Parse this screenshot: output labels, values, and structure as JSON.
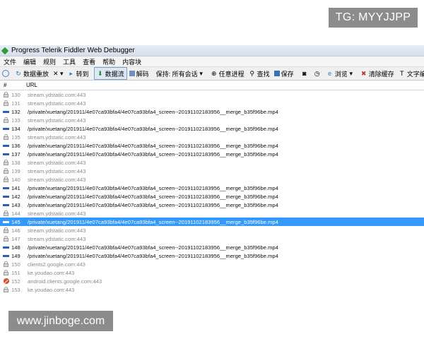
{
  "watermark_top": "TG: MYYJJPP",
  "watermark_bottom": "www.jinboge.com",
  "window": {
    "title": "Progress Telerik Fiddler Web Debugger"
  },
  "menu": [
    "文件",
    "编辑",
    "规则",
    "工具",
    "查看",
    "帮助",
    "内容块"
  ],
  "toolbar": {
    "comment_icon": "speech-bubble-icon",
    "replay": "数据重放",
    "remove": "✕ ▾",
    "goto": "转到",
    "stream": "数据流",
    "decode": "解码",
    "keep": "保持: 所有会话",
    "any_process": "任意进程",
    "find": "查找",
    "save": "保存",
    "browse": "浏览",
    "clear_cache": "清除缓存",
    "text_wizard": "文字编/解"
  },
  "columns": {
    "num": "#",
    "url": "URL"
  },
  "sessions": [
    {
      "num": "130",
      "url": "stream.ydstatic.com:443",
      "type": "tunnel"
    },
    {
      "num": "131",
      "url": "stream.ydstatic.com:443",
      "type": "tunnel"
    },
    {
      "num": "132",
      "url": "/private/xuetang/201911/4e07ca93bfa4/4e07ca93bfa4_screen--20191102183956__merge_b35f96be.mp4",
      "type": "media"
    },
    {
      "num": "133",
      "url": "stream.ydstatic.com:443",
      "type": "tunnel"
    },
    {
      "num": "134",
      "url": "/private/xuetang/201911/4e07ca93bfa4/4e07ca93bfa4_screen--20191102183956__merge_b35f96be.mp4",
      "type": "media"
    },
    {
      "num": "135",
      "url": "stream.ydstatic.com:443",
      "type": "tunnel"
    },
    {
      "num": "136",
      "url": "/private/xuetang/201911/4e07ca93bfa4/4e07ca93bfa4_screen--20191102183956__merge_b35f96be.mp4",
      "type": "media"
    },
    {
      "num": "137",
      "url": "/private/xuetang/201911/4e07ca93bfa4/4e07ca93bfa4_screen--20191102183956__merge_b35f96be.mp4",
      "type": "media"
    },
    {
      "num": "138",
      "url": "stream.ydstatic.com:443",
      "type": "tunnel"
    },
    {
      "num": "139",
      "url": "stream.ydstatic.com:443",
      "type": "tunnel"
    },
    {
      "num": "140",
      "url": "stream.ydstatic.com:443",
      "type": "tunnel"
    },
    {
      "num": "141",
      "url": "/private/xuetang/201911/4e07ca93bfa4/4e07ca93bfa4_screen--20191102183956__merge_b35f96be.mp4",
      "type": "media"
    },
    {
      "num": "142",
      "url": "/private/xuetang/201911/4e07ca93bfa4/4e07ca93bfa4_screen--20191102183956__merge_b35f96be.mp4",
      "type": "media"
    },
    {
      "num": "143",
      "url": "/private/xuetang/201911/4e07ca93bfa4/4e07ca93bfa4_screen--20191102183956__merge_b35f96be.mp4",
      "type": "media"
    },
    {
      "num": "144",
      "url": "stream.ydstatic.com:443",
      "type": "tunnel"
    },
    {
      "num": "145",
      "url": "/private/xuetang/201911/4e07ca93bfa4/4e07ca93bfa4_screen--20191102183956__merge_b35f96be.mp4",
      "type": "media",
      "selected": true
    },
    {
      "num": "146",
      "url": "stream.ydstatic.com:443",
      "type": "tunnel"
    },
    {
      "num": "147",
      "url": "stream.ydstatic.com:443",
      "type": "tunnel"
    },
    {
      "num": "148",
      "url": "/private/xuetang/201911/4e07ca93bfa4/4e07ca93bfa4_screen--20191102183956__merge_b35f96be.mp4",
      "type": "media"
    },
    {
      "num": "149",
      "url": "/private/xuetang/201911/4e07ca93bfa4/4e07ca93bfa4_screen--20191102183956__merge_b35f96be.mp4",
      "type": "media"
    },
    {
      "num": "150",
      "url": "clients2.google.com:443",
      "type": "tunnel"
    },
    {
      "num": "151",
      "url": "ke.youdao.com:443",
      "type": "tunnel"
    },
    {
      "num": "152",
      "url": "android.clients.google.com:443",
      "type": "blocked"
    },
    {
      "num": "153",
      "url": "ke.youdao.com:443",
      "type": "tunnel"
    }
  ],
  "colors": {
    "selected": "#3399ff",
    "media_icon": "#2a62b8",
    "blocked_icon": "#e04b2a"
  }
}
